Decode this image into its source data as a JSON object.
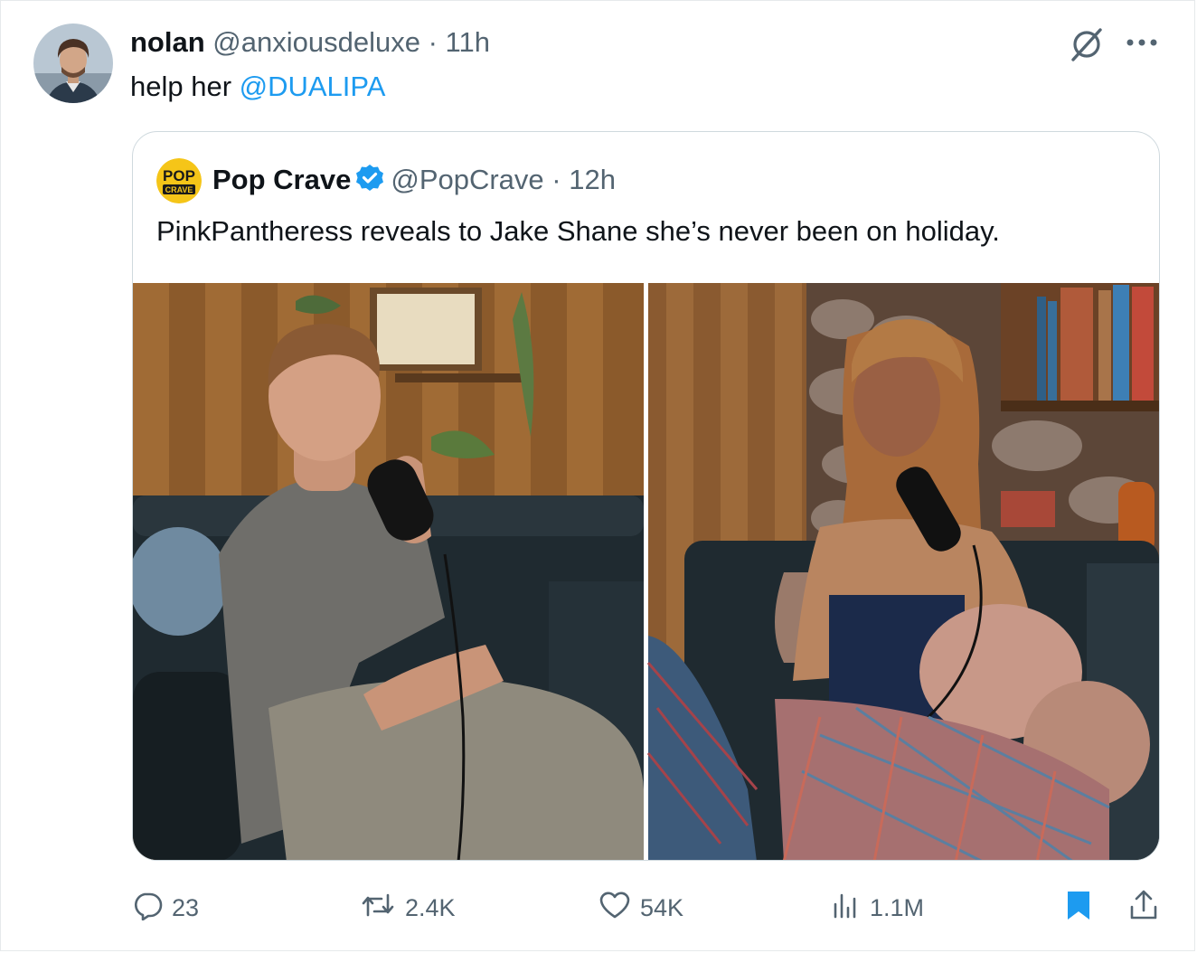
{
  "tweet": {
    "author_name": "nolan",
    "author_handle": "@anxiousdeluxe",
    "separator": " · ",
    "time": "11h",
    "text_prefix": "help her ",
    "mention": "@DUALIPA"
  },
  "quote": {
    "logo_text_top": "POP",
    "logo_text_bottom": "CRAVE",
    "author_name": "Pop Crave",
    "author_handle": "@PopCrave",
    "separator": " · ",
    "time": "12h",
    "text": "PinkPantheress reveals to Jake Shane she’s never been on holiday."
  },
  "actions": {
    "replies": "23",
    "reposts": "2.4K",
    "likes": "54K",
    "views": "1.1M"
  },
  "colors": {
    "accent": "#1d9bf0",
    "muted": "#536471",
    "border": "#cfd9de"
  },
  "icons": [
    "grok-icon",
    "more-icon",
    "verified-badge-icon",
    "reply-icon",
    "repost-icon",
    "like-icon",
    "views-icon",
    "bookmark-icon",
    "share-icon"
  ]
}
